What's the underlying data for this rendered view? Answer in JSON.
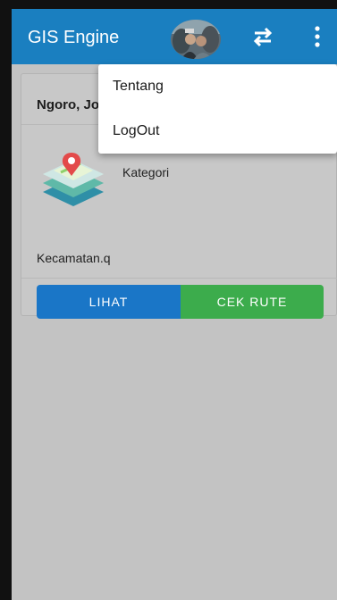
{
  "app": {
    "title": "GIS Engine",
    "accent_color": "#1a7fc0"
  },
  "toolbar": {
    "avatar_icon": "profile-photo",
    "swap_icon": "swap-arrows-icon",
    "more_icon": "more-vert-icon"
  },
  "menu": {
    "items": [
      {
        "label": "Tentang"
      },
      {
        "label": "LogOut"
      }
    ]
  },
  "card": {
    "title": "Ngoro, Jo",
    "category": "Kategori",
    "district": "Kecamatan.q",
    "icon": "map-layers-icon",
    "buttons": {
      "view_label": "LIHAT",
      "view_color": "#1a76c7",
      "route_label": "CEK RUTE",
      "route_color": "#3cac4c"
    }
  }
}
